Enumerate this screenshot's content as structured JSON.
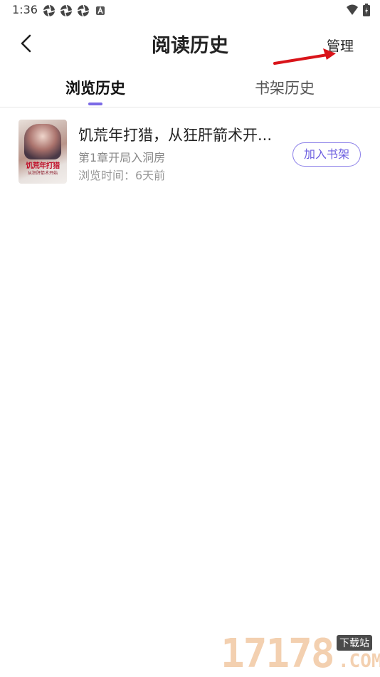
{
  "status_bar": {
    "time": "1:36",
    "icons": [
      "aperture-icon",
      "aperture-icon",
      "aperture-icon",
      "a-notification-icon"
    ],
    "right_icons": [
      "wifi-icon",
      "battery-charging-icon"
    ]
  },
  "header": {
    "title": "阅读历史",
    "manage_label": "管理",
    "back_icon": "chevron-left-icon",
    "annotation_color": "#d9141a"
  },
  "tabs": [
    {
      "label": "浏览历史",
      "active": true
    },
    {
      "label": "书架历史",
      "active": false
    }
  ],
  "accent_color": "#7b6ae6",
  "history": [
    {
      "title": "饥荒年打猎，从狂肝箭术开...",
      "chapter": "第1章开局入洞房",
      "browse_time": "浏览时间：6天前",
      "add_label": "加入书架",
      "cover": {
        "title": "饥荒年打猎",
        "subtitle": "从狂肝箭术开始"
      }
    }
  ],
  "watermark": {
    "number": "17178",
    "tag": "下载站",
    "domain": ".COM"
  }
}
